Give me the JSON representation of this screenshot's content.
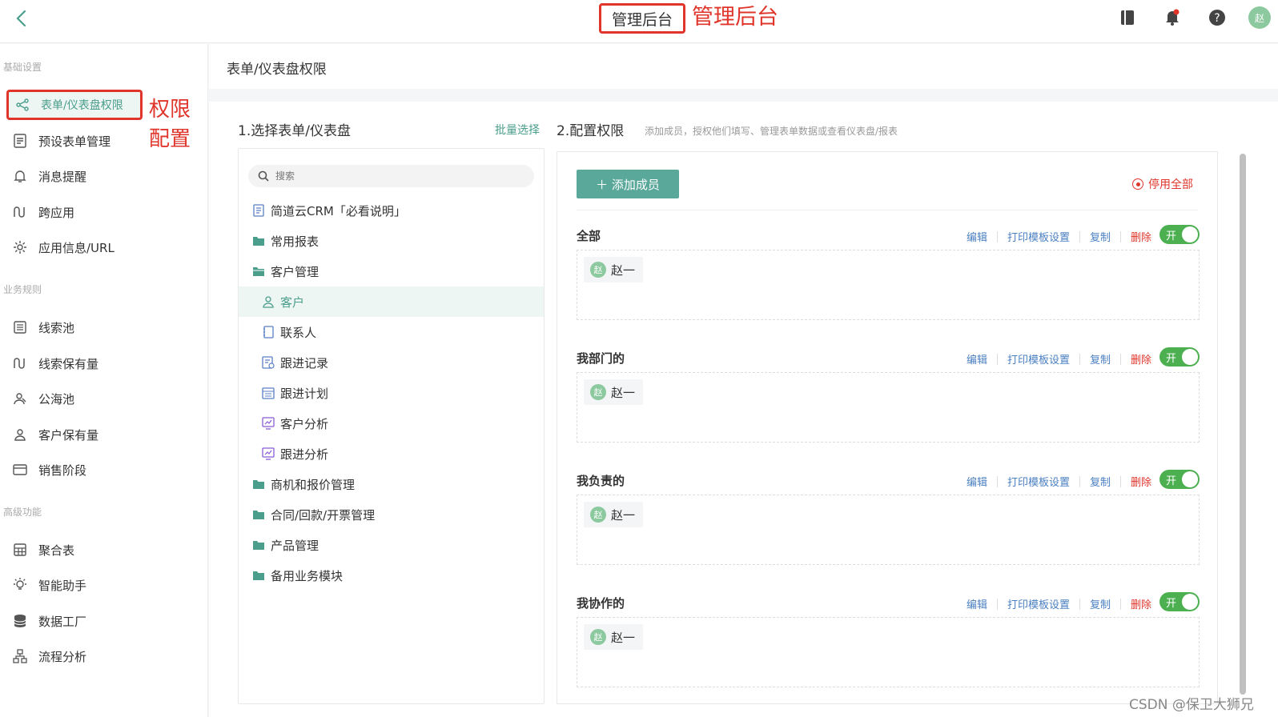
{
  "topbar": {
    "title": "管理后台",
    "title_annotation": "管理后台",
    "avatar": "赵"
  },
  "sidebar": {
    "groups": [
      {
        "title": "基础设置"
      },
      {
        "title": "业务规则"
      },
      {
        "title": "高级功能"
      }
    ],
    "items": [
      {
        "label": "表单/仪表盘权限",
        "icon": "share-icon"
      },
      {
        "label": "预设表单管理",
        "icon": "form-icon"
      },
      {
        "label": "消息提醒",
        "icon": "bell-icon"
      },
      {
        "label": "跨应用",
        "icon": "link-icon"
      },
      {
        "label": "应用信息/URL",
        "icon": "gear-icon"
      },
      {
        "label": "线索池",
        "icon": "list-icon"
      },
      {
        "label": "线索保有量",
        "icon": "link-icon"
      },
      {
        "label": "公海池",
        "icon": "group-icon"
      },
      {
        "label": "客户保有量",
        "icon": "user-icon"
      },
      {
        "label": "销售阶段",
        "icon": "card-icon"
      },
      {
        "label": "聚合表",
        "icon": "table-icon"
      },
      {
        "label": "智能助手",
        "icon": "bulb-icon"
      },
      {
        "label": "数据工厂",
        "icon": "database-icon"
      },
      {
        "label": "流程分析",
        "icon": "flow-icon"
      }
    ],
    "annotation": "权限配置"
  },
  "main": {
    "header": "表单/仪表盘权限",
    "left_title": "1.选择表单/仪表盘",
    "batch_select": "批量选择",
    "search_placeholder": "搜索",
    "tree": [
      {
        "label": "简道云CRM「必看说明」",
        "icon": "doc-icon"
      },
      {
        "label": "常用报表",
        "icon": "folder-icon"
      },
      {
        "label": "客户管理",
        "icon": "folder-open-icon"
      },
      {
        "label": "客户",
        "icon": "user-icon"
      },
      {
        "label": "联系人",
        "icon": "contact-icon"
      },
      {
        "label": "跟进记录",
        "icon": "record-icon"
      },
      {
        "label": "跟进计划",
        "icon": "calendar-icon"
      },
      {
        "label": "客户分析",
        "icon": "chart-icon"
      },
      {
        "label": "跟进分析",
        "icon": "chart-icon"
      },
      {
        "label": "商机和报价管理",
        "icon": "folder-icon"
      },
      {
        "label": "合同/回款/开票管理",
        "icon": "folder-icon"
      },
      {
        "label": "产品管理",
        "icon": "folder-icon"
      },
      {
        "label": "备用业务模块",
        "icon": "folder-icon"
      }
    ],
    "right_title": "2.配置权限",
    "right_desc": "添加成员，授权他们填写、管理表单数据或查看仪表盘/报表",
    "add_member": "＋ 添加成员",
    "disable_all": "停用全部",
    "actions": {
      "edit": "编辑",
      "print": "打印模板设置",
      "copy": "复制",
      "delete": "删除",
      "toggle": "开"
    },
    "groups": [
      {
        "name": "全部",
        "member": "赵一",
        "avatar": "赵"
      },
      {
        "name": "我部门的",
        "member": "赵一",
        "avatar": "赵"
      },
      {
        "name": "我负责的",
        "member": "赵一",
        "avatar": "赵"
      },
      {
        "name": "我协作的",
        "member": "赵一",
        "avatar": "赵"
      }
    ]
  },
  "watermark": "CSDN @保卫大狮兄",
  "colors": {
    "accent": "#4a9e8b",
    "annotation": "#e0352b",
    "toggle_on": "#4caf50",
    "link": "#4a7fc1"
  }
}
